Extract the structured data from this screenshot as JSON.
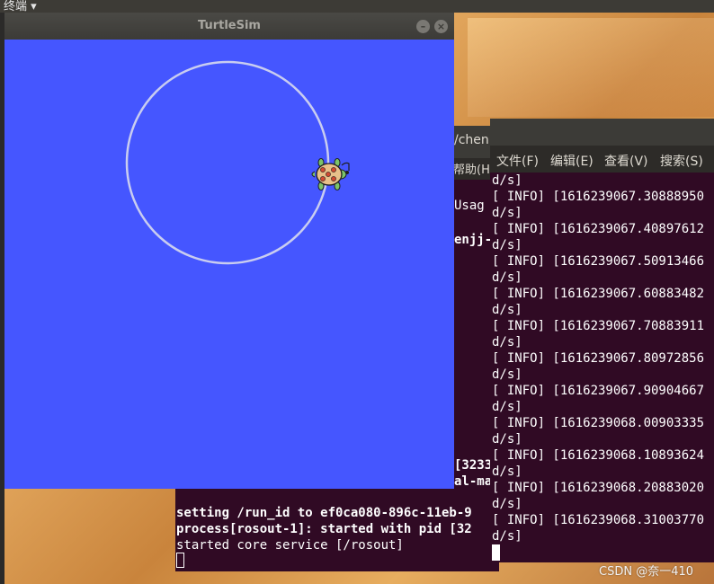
{
  "top_panel": {
    "app_name": "终端 ▾"
  },
  "turtlesim": {
    "title": "TurtleSim",
    "minimize_symbol": "–",
    "close_symbol": "×",
    "background_color": "#4556ff",
    "path_color": "#c9cdf0"
  },
  "back_terminal": {
    "path_fragment": "/chen",
    "help_menu": "帮助(H",
    "lines": [
      "Usag",
      "enjj-",
      "[3233",
      "al-ma"
    ],
    "bottom_lines": [
      "setting /run_id to ef0ca080-896c-11eb-9",
      "process[rosout-1]: started with pid [32",
      "started core service [/rosout]"
    ]
  },
  "front_terminal": {
    "menu": [
      "文件(F)",
      "编辑(E)",
      "查看(V)",
      "搜索(S)"
    ],
    "log_lines": [
      "d/s]",
      "[ INFO] [1616239067.30888950",
      "d/s]",
      "[ INFO] [1616239067.40897612",
      "d/s]",
      "[ INFO] [1616239067.50913466",
      "d/s]",
      "[ INFO] [1616239067.60883482",
      "d/s]",
      "[ INFO] [1616239067.70883911",
      "d/s]",
      "[ INFO] [1616239067.80972856",
      "d/s]",
      "[ INFO] [1616239067.90904667",
      "d/s]",
      "[ INFO] [1616239068.00903335",
      "d/s]",
      "[ INFO] [1616239068.10893624",
      "d/s]",
      "[ INFO] [1616239068.20883020",
      "d/s]",
      "[ INFO] [1616239068.31003770",
      "d/s]"
    ]
  },
  "watermark": "CSDN @奈一410"
}
